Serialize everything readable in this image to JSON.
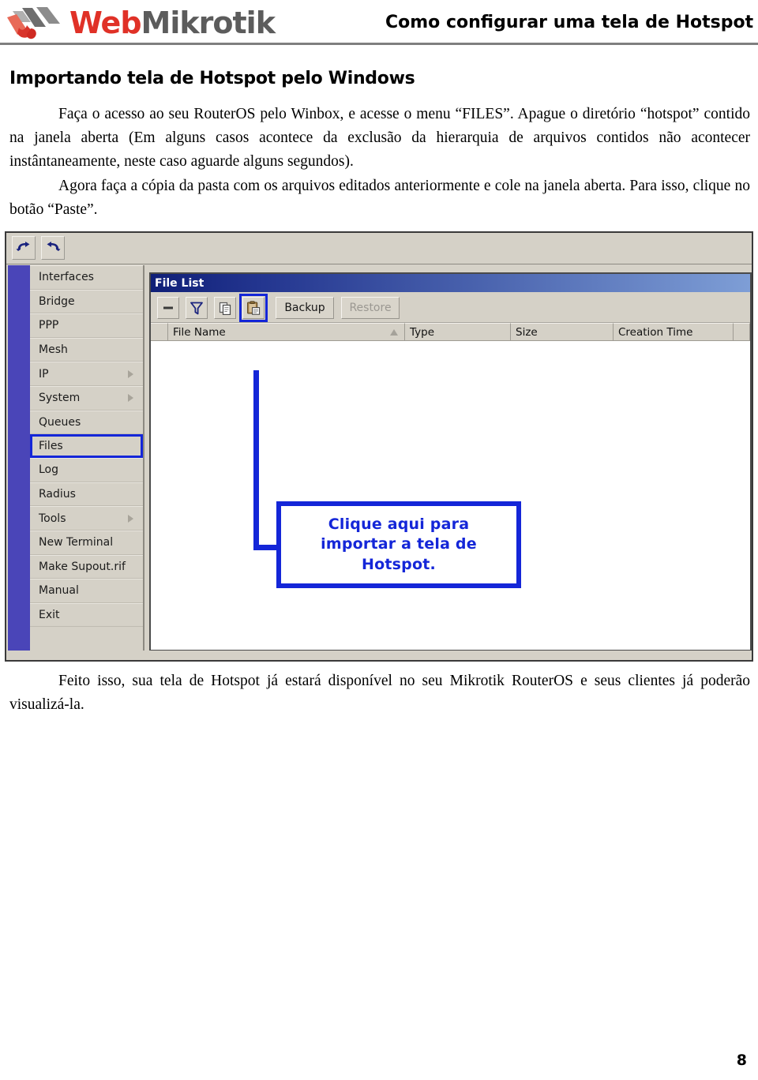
{
  "header": {
    "logo_web": "Web",
    "logo_mikrotik": "Mikrotik",
    "title": "Como configurar uma tela de Hotspot"
  },
  "document": {
    "heading": "Importando tela de Hotspot pelo Windows",
    "paragraph_1": "Faça o acesso ao seu RouterOS pelo Winbox, e acesse o menu “FILES”. Apague o diretório “hotspot” contido na janela aberta (Em alguns casos acontece da exclusão da hierarquia de arquivos contidos não acontecer instântaneamente, neste caso aguarde alguns segundos).",
    "paragraph_2": "Agora faça a cópia da pasta com os arquivos editados anteriormente e cole na janela aberta. Para isso,  clique no botão “Paste”.",
    "paragraph_footer": "Feito isso, sua tela de Hotspot já estará disponível no seu Mikrotik RouterOS e seus clientes já poderão visualizá-la.",
    "page_number": "8"
  },
  "winbox": {
    "toolbar": {
      "undo_icon": "undo-arrow-icon",
      "redo_icon": "redo-arrow-icon"
    },
    "menu_items": [
      {
        "label": "Interfaces",
        "has_submenu": false,
        "selected": false
      },
      {
        "label": "Bridge",
        "has_submenu": false,
        "selected": false
      },
      {
        "label": "PPP",
        "has_submenu": false,
        "selected": false
      },
      {
        "label": "Mesh",
        "has_submenu": false,
        "selected": false
      },
      {
        "label": "IP",
        "has_submenu": true,
        "selected": false
      },
      {
        "label": "System",
        "has_submenu": true,
        "selected": false
      },
      {
        "label": "Queues",
        "has_submenu": false,
        "selected": false
      },
      {
        "label": "Files",
        "has_submenu": false,
        "selected": true
      },
      {
        "label": "Log",
        "has_submenu": false,
        "selected": false
      },
      {
        "label": "Radius",
        "has_submenu": false,
        "selected": false
      },
      {
        "label": "Tools",
        "has_submenu": true,
        "selected": false
      },
      {
        "label": "New Terminal",
        "has_submenu": false,
        "selected": false
      },
      {
        "label": "Make Supout.rif",
        "has_submenu": false,
        "selected": false
      },
      {
        "label": "Manual",
        "has_submenu": false,
        "selected": false
      },
      {
        "label": "Exit",
        "has_submenu": false,
        "selected": false
      }
    ],
    "file_list": {
      "title": "File List",
      "buttons": {
        "remove": "",
        "filter": "",
        "copy": "",
        "paste": "",
        "backup": "Backup",
        "restore": "Restore"
      },
      "columns": [
        "File Name",
        "Type",
        "Size",
        "Creation Time"
      ],
      "rows": []
    },
    "callout": {
      "line_1": "Clique aqui para",
      "line_2": "importar a tela de",
      "line_3": "Hotspot."
    }
  },
  "colors": {
    "logo_red": "#e03127",
    "logo_gray": "#5c5c5c",
    "annotation_blue": "#1426d8",
    "titlebar_dark": "#101f77",
    "titlebar_light": "#7e9ed6",
    "rail_purple": "#4a45b8",
    "chrome_gray": "#d5d1c7"
  }
}
